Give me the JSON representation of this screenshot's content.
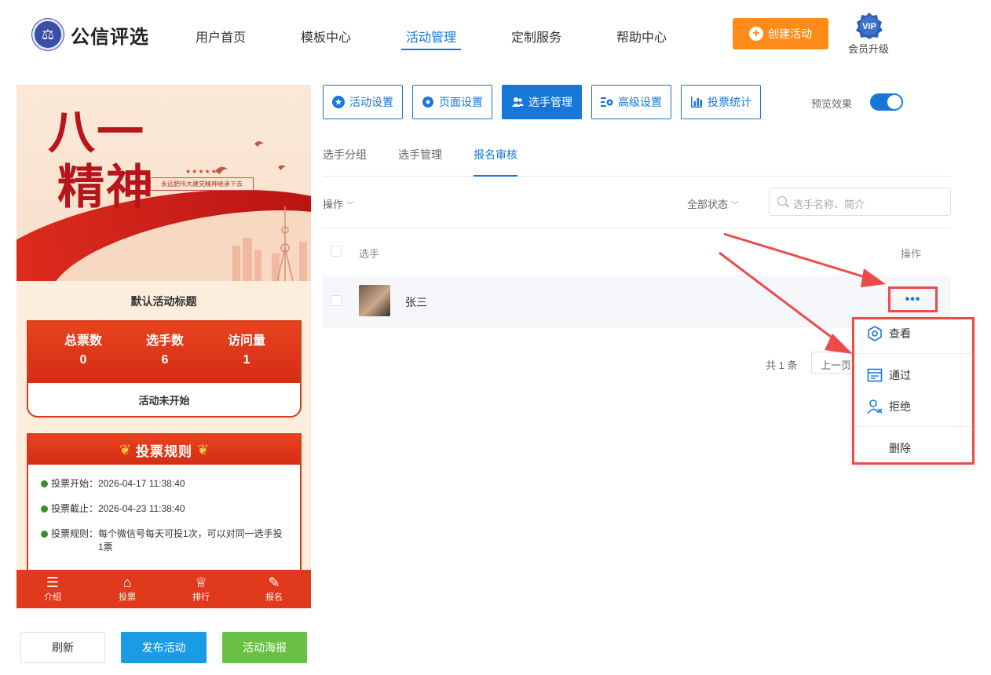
{
  "header": {
    "logo_text": "公信评选",
    "nav": [
      "用户首页",
      "模板中心",
      "活动管理",
      "定制服务",
      "帮助中心"
    ],
    "active_nav": "活动管理",
    "create_button": "创建活动",
    "vip_badge": "VIP",
    "vip_label": "会员升级"
  },
  "preview": {
    "banner_title_line1": "八一",
    "banner_title_line2": "精神",
    "banner_subtitle": "永远肥伟大建党精神继承下去",
    "activity_title": "默认活动标题",
    "stats": [
      {
        "label": "总票数",
        "value": "0"
      },
      {
        "label": "选手数",
        "value": "6"
      },
      {
        "label": "访问量",
        "value": "1"
      }
    ],
    "status_text": "活动未开始",
    "rules_title": "投票规则",
    "rules": [
      "投票开始：2026-04-17 11:38:40",
      "投票截止：2026-04-23 11:38:40",
      "投票规则：每个微信号每天可投1次，可以对同一选手投",
      "1票"
    ],
    "tabs": [
      "介绍",
      "投票",
      "排行",
      "报名"
    ]
  },
  "bottom_buttons": {
    "refresh": "刷新",
    "publish": "发布活动",
    "poster": "活动海报"
  },
  "toolbar": {
    "buttons": [
      "活动设置",
      "页面设置",
      "选手管理",
      "高级设置",
      "投票统计"
    ],
    "active": "选手管理",
    "preview_label": "预览效果",
    "preview_on": true
  },
  "subtabs": {
    "items": [
      "选手分组",
      "选手管理",
      "报名审核"
    ],
    "active": "报名审核"
  },
  "filters": {
    "ops_label": "操作",
    "status_label": "全部状态",
    "search_placeholder": "选手名称、简介"
  },
  "table": {
    "columns": [
      "选手",
      "操作"
    ],
    "rows": [
      {
        "name": "张三",
        "action": "•••"
      }
    ]
  },
  "pager": {
    "total": "共 1 条",
    "prev": "上一页"
  },
  "dropdown": {
    "items": [
      "查看",
      "通过",
      "拒绝",
      "删除"
    ]
  },
  "colors": {
    "primary": "#1677d9",
    "orange": "#ff8c1a",
    "publish": "#1a9be6",
    "poster": "#6ac045",
    "annotation": "#ec4b4b",
    "festive_red": "#d73a1d"
  }
}
